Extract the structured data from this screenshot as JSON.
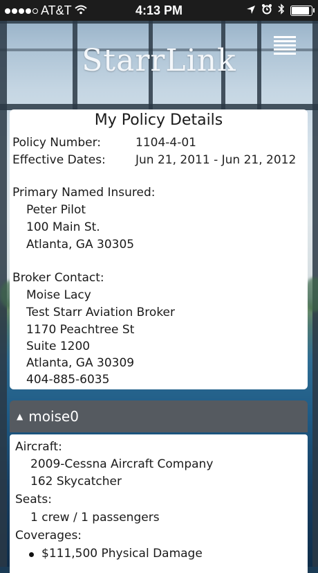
{
  "status_bar": {
    "carrier": "AT&T",
    "time": "4:13 PM"
  },
  "app": {
    "logo": "StarrLink"
  },
  "policy": {
    "title": "My Policy Details",
    "policy_number_label": "Policy Number:",
    "policy_number": "1104-4-01",
    "effective_dates_label": "Effective Dates:",
    "effective_dates": "Jun 21, 2011 - Jun 21, 2012",
    "primary_insured_label": "Primary Named Insured:",
    "primary_insured": [
      "Peter Pilot",
      "100 Main St.",
      "Atlanta, GA   30305"
    ],
    "broker_label": "Broker Contact:",
    "broker": [
      "Moise Lacy",
      "Test Starr Aviation Broker",
      "1170 Peachtree St",
      "Suite 1200",
      "Atlanta, GA   30309",
      "404-885-6035"
    ]
  },
  "section": {
    "caret": "▲",
    "name": "moise0"
  },
  "aircraft": {
    "aircraft_label": "Aircraft:",
    "aircraft_lines": [
      "2009-Cessna Aircraft Company",
      "162 Skycatcher"
    ],
    "seats_label": "Seats:",
    "seats": "1 crew / 1 passengers",
    "coverages_label": "Coverages:",
    "coverages": [
      "$111,500 Physical Damage"
    ]
  }
}
